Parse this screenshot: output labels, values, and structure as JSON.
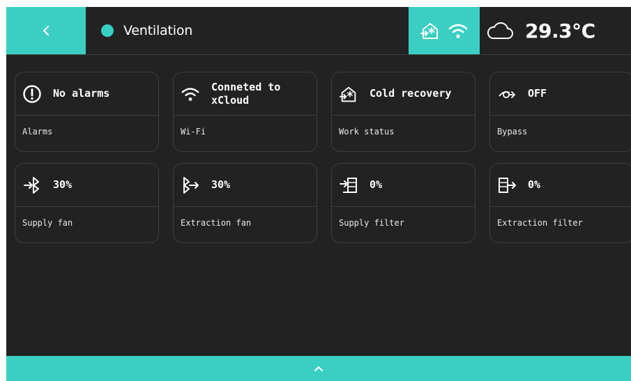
{
  "colors": {
    "accent": "#3bcfc4",
    "background": "#222222",
    "border": "#3e3e3e",
    "text": "#ffffff"
  },
  "header": {
    "title": "Ventilation",
    "temperature": "29.3°C",
    "icons": {
      "back": "chevron-left-icon",
      "status": "status-dot",
      "connection": [
        "house-snowflake-icon",
        "wifi-icon"
      ],
      "weather": "cloud-icon"
    }
  },
  "cards": [
    {
      "value": "No alarms",
      "label": "Alarms",
      "icon": "alert-circle-icon"
    },
    {
      "value_line1": "Conneted to",
      "value_line2": "xCloud",
      "label": "Wi-Fi",
      "icon": "wifi-icon"
    },
    {
      "value": "Cold recovery",
      "label": "Work status",
      "icon": "house-snowflake-icon"
    },
    {
      "value": "OFF",
      "label": "Bypass",
      "icon": "bypass-icon"
    },
    {
      "value": "30%",
      "label": "Supply fan",
      "icon": "supply-fan-icon"
    },
    {
      "value": "30%",
      "label": "Extraction fan",
      "icon": "extraction-fan-icon"
    },
    {
      "value": "0%",
      "label": "Supply filter",
      "icon": "supply-filter-icon"
    },
    {
      "value": "0%",
      "label": "Extraction filter",
      "icon": "extraction-filter-icon"
    }
  ],
  "footer": {
    "icon": "chevron-up-icon"
  }
}
